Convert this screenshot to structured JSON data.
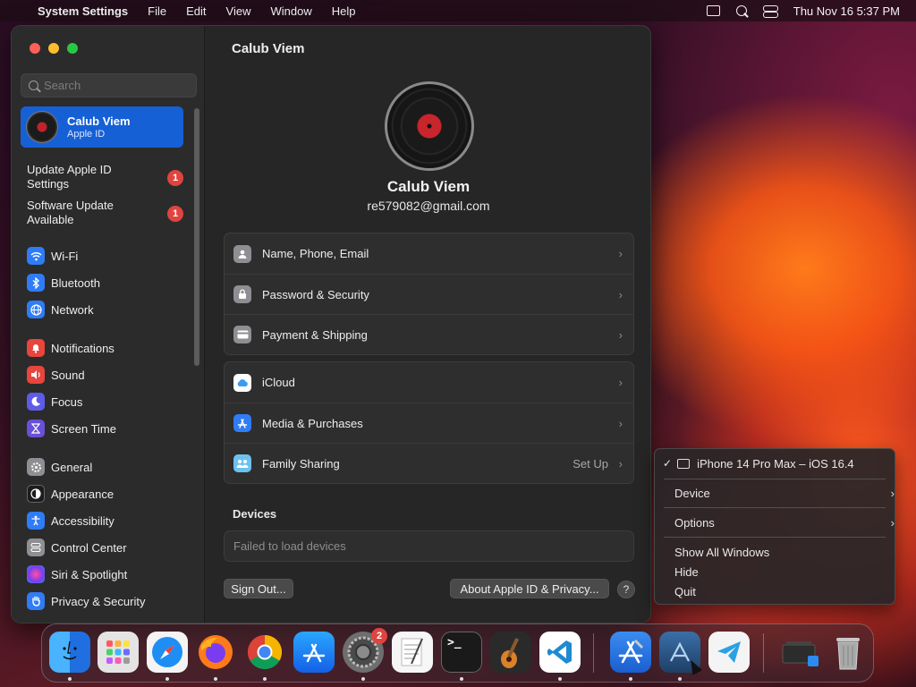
{
  "menubar": {
    "app_name": "System Settings",
    "menus": [
      "File",
      "Edit",
      "View",
      "Window",
      "Help"
    ],
    "clock": "Thu Nov 16  5:37 PM"
  },
  "sidebar": {
    "search_placeholder": "Search",
    "profile": {
      "name": "Calub Viem",
      "subtitle": "Apple ID"
    },
    "alerts": [
      {
        "label": "Update Apple ID Settings",
        "badge": "1"
      },
      {
        "label": "Software Update Available",
        "badge": "1"
      }
    ],
    "items": [
      {
        "label": "Wi-Fi",
        "icon": "wifi-icon",
        "color": "#2f7cf6"
      },
      {
        "label": "Bluetooth",
        "icon": "bluetooth-icon",
        "color": "#2f7cf6"
      },
      {
        "label": "Network",
        "icon": "globe-icon",
        "color": "#2f7cf6"
      },
      {
        "label": "Notifications",
        "icon": "bell-icon",
        "color": "#e8453c"
      },
      {
        "label": "Sound",
        "icon": "speaker-icon",
        "color": "#e8453c"
      },
      {
        "label": "Focus",
        "icon": "moon-icon",
        "color": "#5e5ce6"
      },
      {
        "label": "Screen Time",
        "icon": "hourglass-icon",
        "color": "#6a4fd8"
      },
      {
        "label": "General",
        "icon": "gear-icon",
        "color": "#8e8e93"
      },
      {
        "label": "Appearance",
        "icon": "appearance-icon",
        "color": "#1c1c1e"
      },
      {
        "label": "Accessibility",
        "icon": "accessibility-icon",
        "color": "#2f7cf6"
      },
      {
        "label": "Control Center",
        "icon": "control-center-icon",
        "color": "#8e8e93"
      },
      {
        "label": "Siri & Spotlight",
        "icon": "siri-icon",
        "color": "#b24bd6"
      },
      {
        "label": "Privacy & Security",
        "icon": "hand-icon",
        "color": "#2f7cf6"
      }
    ]
  },
  "main": {
    "title": "Calub Viem",
    "name": "Calub Viem",
    "email": "re579082@gmail.com",
    "group1": [
      {
        "label": "Name, Phone, Email",
        "icon": "contact-icon",
        "color": "#8e8e93"
      },
      {
        "label": "Password & Security",
        "icon": "lock-icon",
        "color": "#8e8e93"
      },
      {
        "label": "Payment & Shipping",
        "icon": "card-icon",
        "color": "#8e8e93"
      }
    ],
    "group2": [
      {
        "label": "iCloud",
        "icon": "cloud-icon",
        "color": "#ffffff",
        "value": ""
      },
      {
        "label": "Media & Purchases",
        "icon": "appstore-icon",
        "color": "#2f7cf6",
        "value": ""
      },
      {
        "label": "Family Sharing",
        "icon": "family-icon",
        "color": "#6cc2ee",
        "value": "Set Up"
      }
    ],
    "devices_title": "Devices",
    "devices_status": "Failed to load devices",
    "sign_out": "Sign Out...",
    "about": "About Apple ID & Privacy...",
    "help": "?"
  },
  "context_menu": {
    "current_device": "iPhone 14 Pro Max – iOS 16.4",
    "device": "Device",
    "options": "Options",
    "show_all": "Show All Windows",
    "hide": "Hide",
    "quit": "Quit"
  },
  "dock": {
    "apps": [
      {
        "name": "finder",
        "color": "#2a8cf0",
        "running": true
      },
      {
        "name": "launchpad",
        "color": "#d8d8d8",
        "running": true
      },
      {
        "name": "safari",
        "color": "#1e8ef5",
        "running": true
      },
      {
        "name": "firefox",
        "color": "#ff6a1f",
        "running": true
      },
      {
        "name": "chrome",
        "color": "#f2f2f2",
        "running": true
      },
      {
        "name": "app-store",
        "color": "#1a8cf5",
        "running": false
      },
      {
        "name": "system-settings",
        "color": "#7a7a7a",
        "running": true,
        "badge": "2"
      },
      {
        "name": "textedit",
        "color": "#f4f4f4",
        "running": false
      },
      {
        "name": "terminal",
        "color": "#1a1a1a",
        "running": true
      },
      {
        "name": "garageband",
        "color": "#3a3a3a",
        "running": false
      },
      {
        "name": "vscode",
        "color": "#ffffff",
        "running": true
      },
      {
        "name": "xcode",
        "color": "#2a6fd6",
        "running": true
      },
      {
        "name": "simulator",
        "color": "#3a6fa8",
        "running": true
      },
      {
        "name": "telegram",
        "color": "#f4f4f4",
        "running": false
      },
      {
        "name": "downloads",
        "color": "#2a2a2a",
        "running": false
      },
      {
        "name": "trash",
        "color": "#9a9a9a",
        "running": false
      }
    ],
    "terminal_prompt": ">_"
  }
}
